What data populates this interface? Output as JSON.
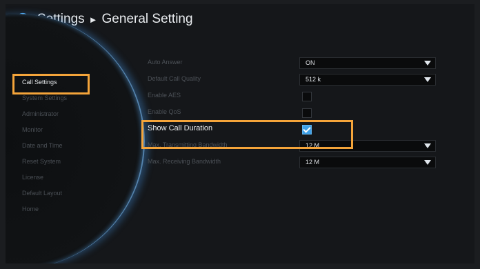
{
  "header": {
    "title": "Settings",
    "separator": "►",
    "subtitle": "General Setting",
    "icon": "gear-icon"
  },
  "sidebar": {
    "items": [
      {
        "label": "Call Settings",
        "active": true
      },
      {
        "label": "System Settings"
      },
      {
        "label": "Administrator"
      },
      {
        "label": "Monitor"
      },
      {
        "label": "Date and Time"
      },
      {
        "label": "Reset System"
      },
      {
        "label": "License"
      },
      {
        "label": "Default Layout"
      },
      {
        "label": "Home"
      }
    ]
  },
  "settings": {
    "auto_answer": {
      "label": "Auto Answer",
      "value": "ON"
    },
    "default_call_quality": {
      "label": "Default Call Quality",
      "value": "512 k"
    },
    "enable_aes": {
      "label": "Enable AES",
      "checked": false
    },
    "enable_qos": {
      "label": "Enable QoS",
      "checked": false
    },
    "show_call_duration": {
      "label": "Show Call Duration",
      "checked": true
    },
    "max_tx_bandwidth": {
      "label": "Max. Transmitting Bandwidth",
      "value": "12 M"
    },
    "max_rx_bandwidth": {
      "label": "Max. Receiving Bandwidth",
      "value": "12 M"
    }
  },
  "colors": {
    "highlight": "#f4a43a",
    "accent": "#3ea0e8"
  }
}
